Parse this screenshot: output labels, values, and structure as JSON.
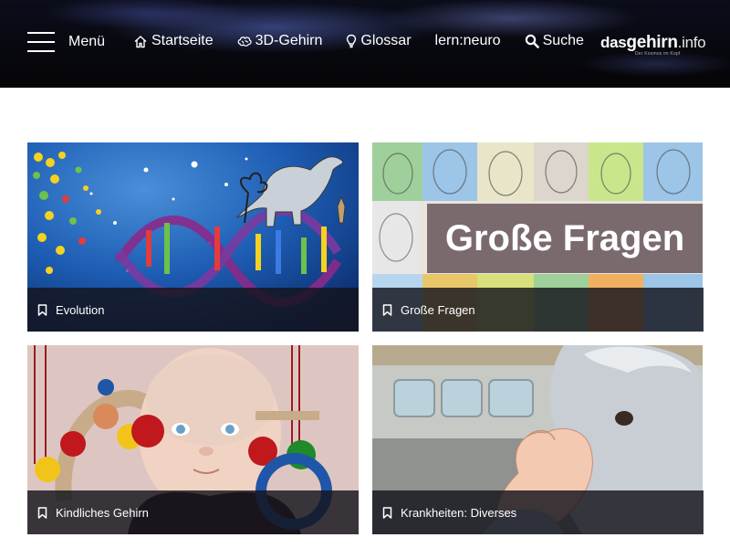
{
  "header": {
    "menu_label": "Menü",
    "nav": [
      {
        "label": "Startseite",
        "icon": "home-icon"
      },
      {
        "label": "3D-Gehirn",
        "icon": "brain-icon"
      },
      {
        "label": "Glossar",
        "icon": "lightbulb-icon"
      },
      {
        "label": "lern:neuro",
        "icon": ""
      },
      {
        "label": "Suche",
        "icon": "search-icon"
      }
    ],
    "logo": {
      "das": "das",
      "gehirn": "gehirn",
      "info": ".info",
      "tagline": "Der Kosmos im Kopf"
    }
  },
  "cards": [
    {
      "title": "Evolution",
      "icon": "bookmark-icon"
    },
    {
      "title": "Große Fragen",
      "icon": "bookmark-icon",
      "image_text": "Große Fragen"
    },
    {
      "title": "Kindliches Gehirn",
      "icon": "bookmark-icon"
    },
    {
      "title": "Krankheiten: Diverses",
      "icon": "bookmark-icon"
    }
  ],
  "colors": {
    "header_bg": "#050507",
    "card_bar_bg": "#14141c",
    "text_light": "#ffffff"
  }
}
